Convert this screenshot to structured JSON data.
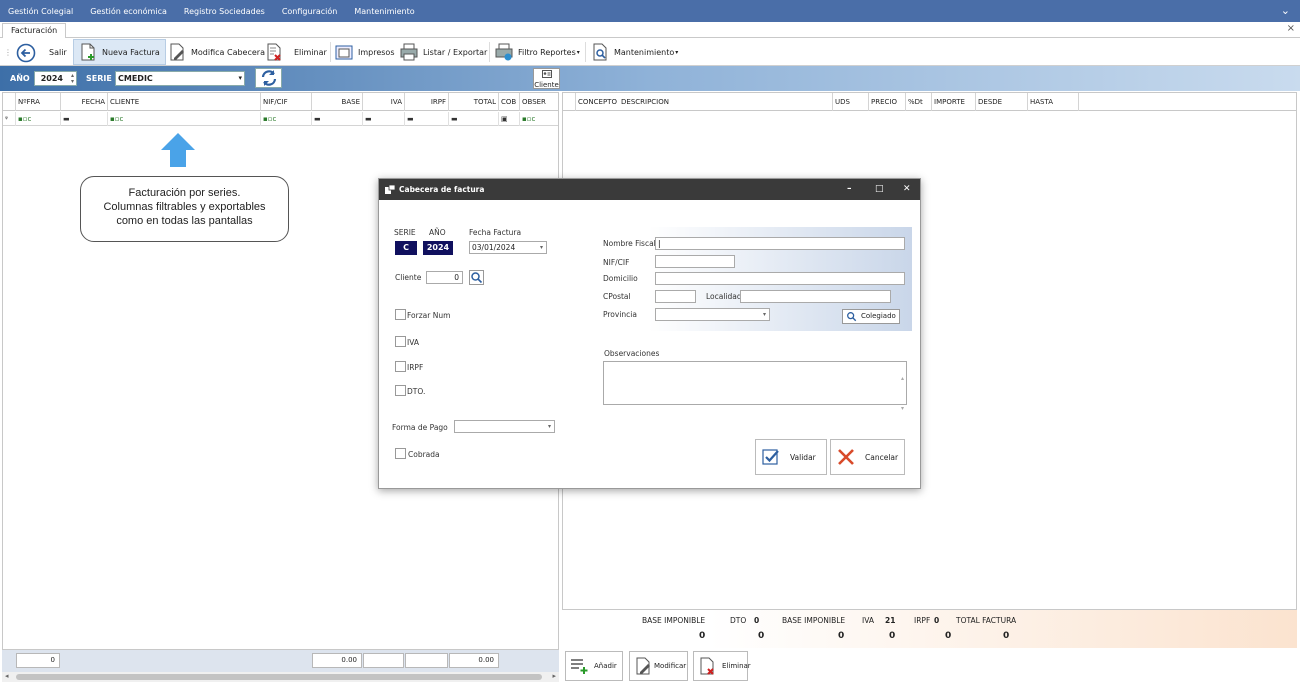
{
  "menu": {
    "items": [
      "Gestión Colegial",
      "Gestión económica",
      "Registro Sociedades",
      "Configuración",
      "Mantenimiento"
    ],
    "chevron": "⌄"
  },
  "tabs": {
    "active": "Facturación",
    "close_glyph": "×"
  },
  "toolbar": {
    "salir": "Salir",
    "nueva_factura": "Nueva Factura",
    "modifica_cabecera": "Modifica Cabecera",
    "eliminar": "Eliminar",
    "impresos": "Impresos",
    "listar_exportar": "Listar / Exportar",
    "filtro_reportes": "Filtro Reportes",
    "mantenimiento": "Mantenimiento"
  },
  "filters": {
    "year_label": "AÑO",
    "year_value": "2024",
    "serie_label": "SERIE",
    "serie_value": "CMEDIC",
    "cliente_button": "Cliente"
  },
  "left_grid": {
    "columns": [
      "NºFRA",
      "FECHA",
      "CLIENTE",
      "NIF/CIF",
      "BASE",
      "IVA",
      "IRPF",
      "TOTAL",
      "COB",
      "OBSER"
    ]
  },
  "right_grid": {
    "columns": [
      "CONCEPTO",
      "DESCRIPCION",
      "UDS",
      "PRECIO",
      "%Dt",
      "IMPORTE",
      "DESDE",
      "HASTA"
    ]
  },
  "totals": {
    "base_imponible_1_label": "BASE IMPONIBLE",
    "base_imponible_1_value": "0",
    "dto_label": "DTO",
    "dto_pct": "0",
    "dto_value": "0",
    "base_imponible_2_label": "BASE IMPONIBLE",
    "base_imponible_2_value": "0",
    "iva_label": "IVA",
    "iva_pct": "21",
    "iva_value": "0",
    "irpf_label": "IRPF",
    "irpf_pct": "0",
    "irpf_value": "0",
    "total_label": "TOTAL FACTURA",
    "total_value": "0"
  },
  "left_summary": {
    "count": "0",
    "base": "0.00",
    "total": "0.00"
  },
  "detail_buttons": {
    "add": "Añadir",
    "modify": "Modificar",
    "delete": "Eliminar"
  },
  "callout": {
    "line1": "Facturación por series.",
    "line2": "Columnas filtrables y exportables",
    "line3": "como en todas las pantallas"
  },
  "dialog": {
    "title": "Cabecera de factura",
    "serie_label": "SERIE",
    "anio_label": "AÑO",
    "fecha_label": "Fecha Factura",
    "serie_value": "C",
    "anio_value": "2024",
    "fecha_value": "03/01/2024",
    "cliente_label": "Cliente",
    "cliente_value": "0",
    "forzar_num": "Forzar Num",
    "iva": "IVA",
    "irpf": "IRPF",
    "dto": "DTO.",
    "forma_pago_label": "Forma de Pago",
    "cobrada": "Cobrada",
    "nombre_fiscal_label": "Nombre Fiscal",
    "nif_label": "NIF/CIF",
    "domicilio_label": "Domicilio",
    "cpostal_label": "CPostal",
    "localidad_label": "Localidad",
    "provincia_label": "Provincia",
    "colegiado_button": "Colegiado",
    "observaciones_label": "Observaciones",
    "validar": "Validar",
    "cancelar": "Cancelar",
    "minimize": "–",
    "maximize": "□",
    "close": "✕"
  },
  "colors": {
    "menubar": "#4a6ea8",
    "accent_blue": "#3d6fa8",
    "dialog_title": "#3a3a3a",
    "dark_field": "#10105e",
    "arrow": "#4aa3e8"
  }
}
